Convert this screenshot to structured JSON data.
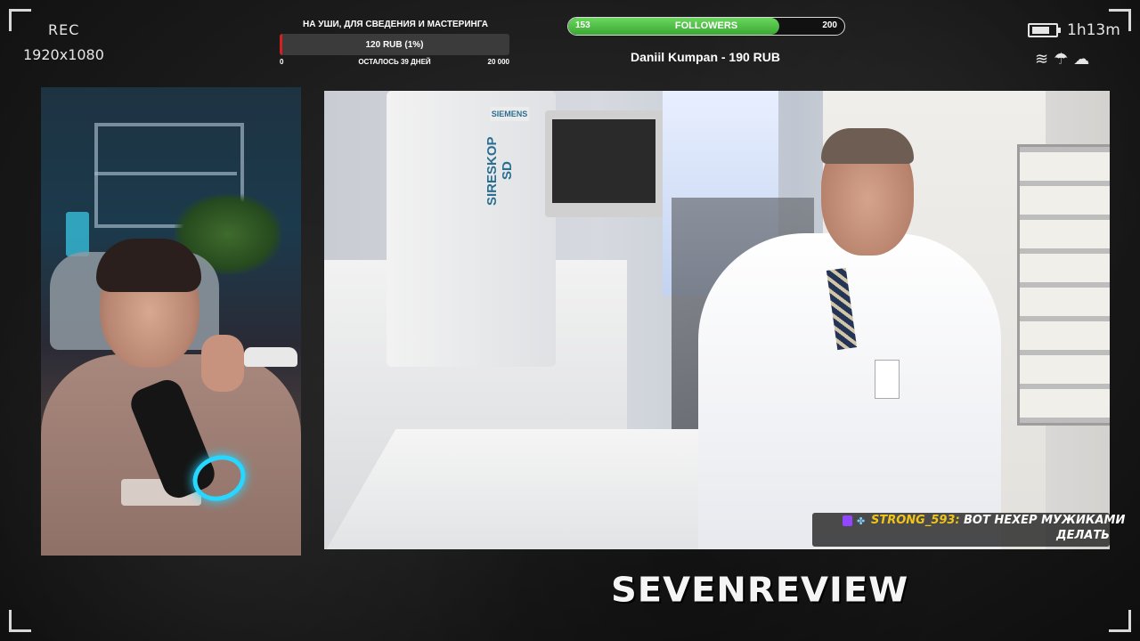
{
  "recording": {
    "rec_label": "REC",
    "resolution": "1920x1080"
  },
  "donation_goal": {
    "title": "НА УШИ, ДЛЯ СВЕДЕНИЯ И МАСТЕРИНГА",
    "amount_text": "120 RUB (1%)",
    "min_label": "0",
    "remaining_label": "ОСТАЛОСЬ 39 ДНЕЙ",
    "max_label": "20 000",
    "progress_percent": 1,
    "fill_color": "#d32020"
  },
  "followers_goal": {
    "current": "153",
    "label": "FOLLOWERS",
    "target": "200",
    "progress_fraction": 0.765,
    "fill_color": "#4cbf40"
  },
  "last_donation": "Daniil Kumpan - 190 RUB",
  "status": {
    "battery_level_fraction": 0.8,
    "elapsed_time": "1h13m",
    "weather_icons": [
      "wind-icon",
      "rain-icon",
      "cloud-icon"
    ]
  },
  "video": {
    "machine_brand": "SIEMENS",
    "machine_model": "SIRESKOP SD"
  },
  "chat": {
    "platform_icon": "twitch-icon",
    "username": "STRONG_593:",
    "message_line1": "ВОТ НЕХЕР МУЖИКАМИ",
    "message_line2": "ДЕЛАТЬ",
    "username_color": "#f0c418"
  },
  "brand_name": "SEVENREVIEW"
}
